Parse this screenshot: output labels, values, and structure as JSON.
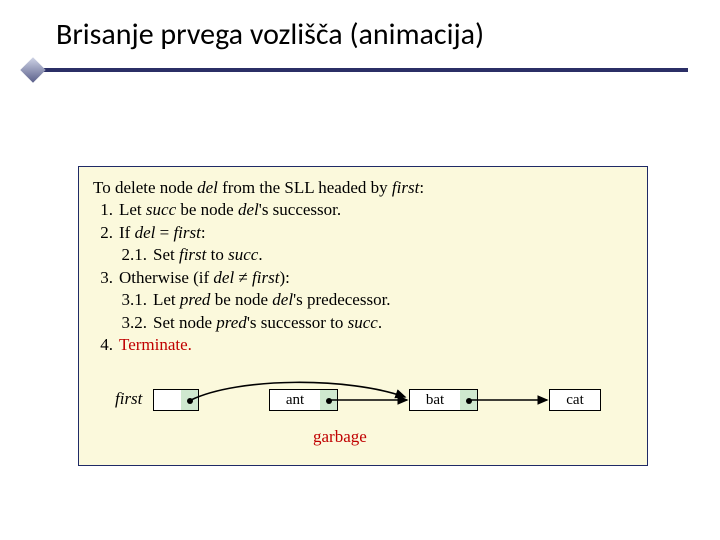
{
  "title": "Brisanje prvega vozlišča (animacija)",
  "algorithm": {
    "intro_prefix": "To delete node ",
    "del": "del",
    "intro_mid": " from the SLL headed by ",
    "first": "first",
    "colon": ":",
    "s1": {
      "num": "1.",
      "a": "Let ",
      "succ": "succ",
      "b": " be node ",
      "c": "'s successor."
    },
    "s2": {
      "num": "2.",
      "a": "If ",
      "b": " = "
    },
    "s21": {
      "num": "2.1.",
      "a": "Set ",
      "b": " to ",
      "dot": "."
    },
    "s3": {
      "num": "3.",
      "a": "Otherwise (if ",
      "neq": " ≠ ",
      "b": "):"
    },
    "s31": {
      "num": "3.1.",
      "a": "Let ",
      "pred": "pred",
      "b": " be node ",
      "c": "'s predecessor."
    },
    "s32": {
      "num": "3.2.",
      "a": "Set node ",
      "b": "'s successor to ",
      "dot": "."
    },
    "s4": {
      "num": "4.",
      "term": "Terminate."
    }
  },
  "ll": {
    "first_label": "first",
    "nodes": [
      "ant",
      "bat",
      "cat"
    ],
    "garbage": "garbage"
  }
}
